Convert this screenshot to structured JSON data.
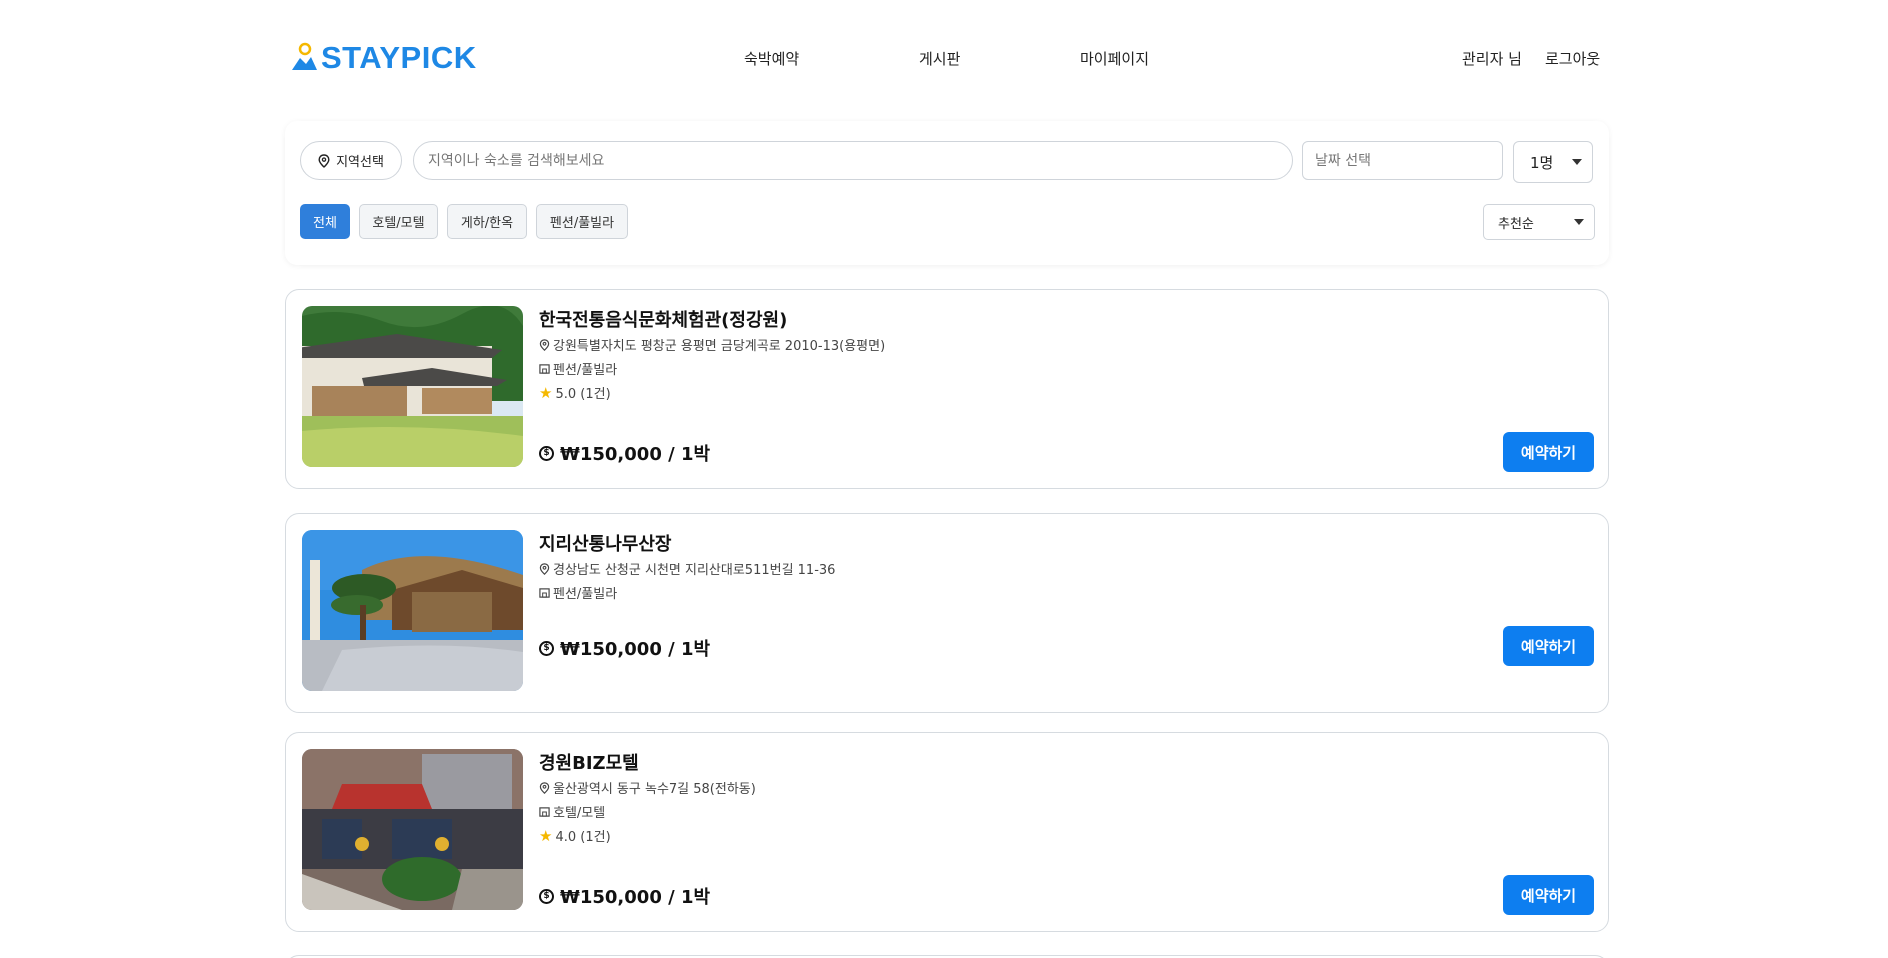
{
  "header": {
    "logo_text": "STAYPICK",
    "nav": [
      "숙박예약",
      "게시판",
      "마이페이지"
    ],
    "user_name": "관리자 님",
    "logout": "로그아웃"
  },
  "search": {
    "region_label": "지역선택",
    "query_placeholder": "지역이나 숙소를 검색해보세요",
    "date_placeholder": "날짜 선택",
    "guests_value": "1명",
    "categories": [
      "전체",
      "호텔/모텔",
      "게하/한옥",
      "펜션/풀빌라"
    ],
    "active_category": "전체",
    "sort_value": "추천순"
  },
  "listings": [
    {
      "name": "한국전통음식문화체험관(정강원)",
      "address": "강원특별자치도 평창군 용평면 금당계곡로 2010-13(용평면)",
      "type": "펜션/풀빌라",
      "rating": "5.0 (1건)",
      "price": "₩150,000 / 1박",
      "book_label": "예약하기"
    },
    {
      "name": "지리산통나무산장",
      "address": "경상남도 산청군 시천면 지리산대로511번길 11-36",
      "type": "펜션/풀빌라",
      "rating": "",
      "price": "₩150,000 / 1박",
      "book_label": "예약하기"
    },
    {
      "name": "경원BIZ모텔",
      "address": "울산광역시 동구 녹수7길 58(전하동)",
      "type": "호텔/모텔",
      "rating": "4.0 (1건)",
      "price": "₩150,000 / 1박",
      "book_label": "예약하기"
    }
  ],
  "colors": {
    "brand": "#1e88e5",
    "primary_button": "#0d7ef0",
    "active_chip": "#2f7fdb",
    "star": "#f5b800"
  }
}
